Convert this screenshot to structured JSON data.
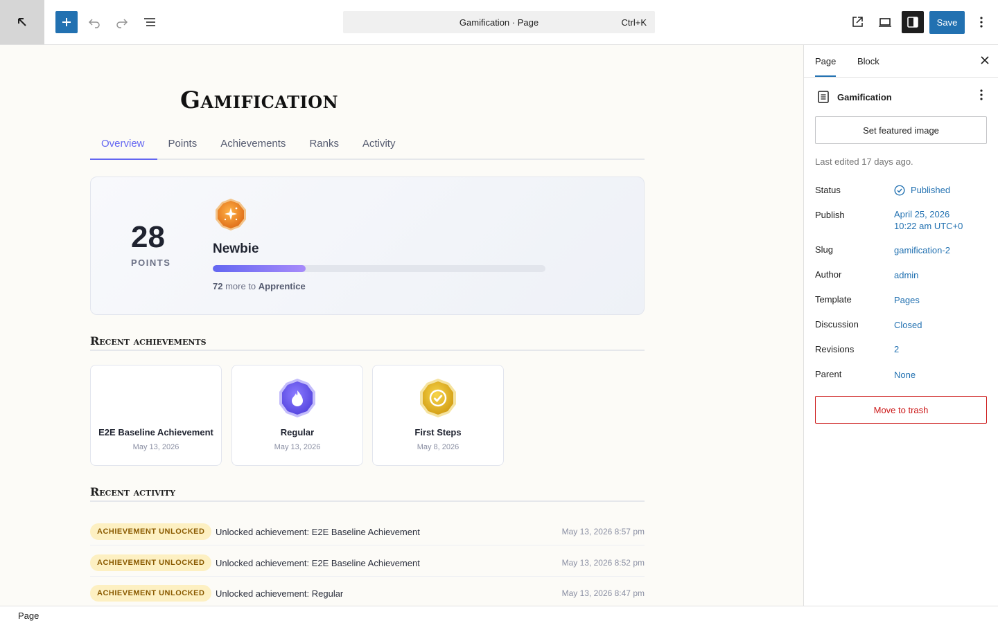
{
  "toolbar": {
    "back_icon": "arrow-up-left-icon",
    "add_icon": "plus-icon",
    "undo_icon": "undo-icon",
    "redo_icon": "redo-icon",
    "list_view_icon": "list-view-icon",
    "command_title": "Gamification · Page",
    "command_shortcut": "Ctrl+K",
    "view_icon": "external-link-icon",
    "device_icon": "desktop-icon",
    "settings_icon": "sidebar-icon",
    "save_label": "Save",
    "more_icon": "vertical-ellipsis-icon"
  },
  "page": {
    "title": "Gamification",
    "tabs": [
      {
        "label": "Overview"
      },
      {
        "label": "Points"
      },
      {
        "label": "Achievements"
      },
      {
        "label": "Ranks"
      },
      {
        "label": "Activity"
      }
    ],
    "active_tab": "Overview",
    "hero": {
      "points": "28",
      "points_label": "POINTS",
      "rank": "Newbie",
      "progress_fraction": 0.28,
      "remaining": "72",
      "more_to": "more to",
      "next_rank": "Apprentice"
    },
    "recent_achievements_heading": "Recent achievements",
    "achievements": [
      {
        "name": "E2E Baseline Achievement",
        "date": "May 13, 2026",
        "badge": "none"
      },
      {
        "name": "Regular",
        "date": "May 13, 2026",
        "badge": "purple-flame-badge"
      },
      {
        "name": "First Steps",
        "date": "May 8, 2026",
        "badge": "gold-check-badge"
      }
    ],
    "recent_activity_heading": "Recent activity",
    "activity": [
      {
        "tag": "ACHIEVEMENT UNLOCKED",
        "text": "Unlocked achievement: E2E Baseline Achievement",
        "time": "May 13, 2026 8:57 pm"
      },
      {
        "tag": "ACHIEVEMENT UNLOCKED",
        "text": "Unlocked achievement: E2E Baseline Achievement",
        "time": "May 13, 2026 8:52 pm"
      },
      {
        "tag": "ACHIEVEMENT UNLOCKED",
        "text": "Unlocked achievement: Regular",
        "time": "May 13, 2026 8:47 pm"
      }
    ]
  },
  "sidebar": {
    "tabs": [
      {
        "label": "Page"
      },
      {
        "label": "Block"
      }
    ],
    "active_tab": "Page",
    "close_icon": "close-icon",
    "doc_title": "Gamification",
    "featured_image_label": "Set featured image",
    "last_edited": "Last edited 17 days ago.",
    "meta": [
      {
        "label": "Status",
        "value": "Published"
      },
      {
        "label": "Publish",
        "value": "April 25, 2026",
        "value2": "10:22 am UTC+0"
      },
      {
        "label": "Slug",
        "value": "gamification-2"
      },
      {
        "label": "Author",
        "value": "admin"
      },
      {
        "label": "Template",
        "value": "Pages"
      },
      {
        "label": "Discussion",
        "value": "Closed"
      },
      {
        "label": "Revisions",
        "value": "2"
      },
      {
        "label": "Parent",
        "value": "None"
      }
    ],
    "trash_label": "Move to trash"
  },
  "footer": {
    "breadcrumb": "Page"
  },
  "colors": {
    "wp_blue": "#2271b1",
    "accent_indigo": "#6366f1",
    "danger": "#cc1818",
    "tag_bg": "#fdf0c2"
  }
}
